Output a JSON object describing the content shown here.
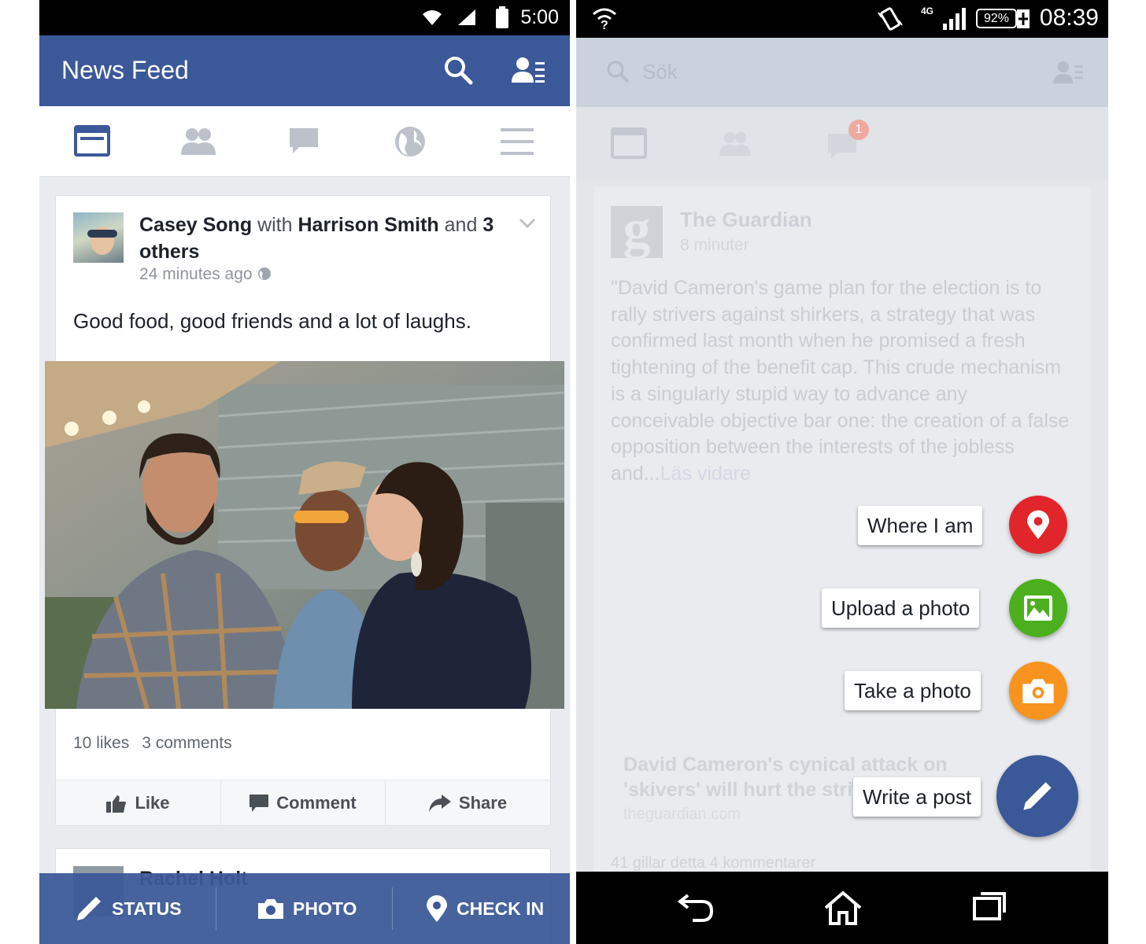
{
  "left_phone": {
    "status_bar": {
      "time": "5:00"
    },
    "app_bar": {
      "title": "News Feed"
    },
    "icons": [
      "search-icon",
      "friend-requests-icon",
      "news-feed-icon",
      "friends-icon",
      "messages-icon",
      "globe-icon",
      "menu-icon"
    ],
    "post": {
      "author": "Casey Song",
      "with_word": "with",
      "tagged": "Harrison Smith",
      "and_word": "and",
      "others": "3 others",
      "time": "24 minutes ago",
      "text": "Good food, good friends and a lot of laughs.",
      "likes": "10 likes",
      "comments": "3 comments",
      "actions": {
        "like": "Like",
        "comment": "Comment",
        "share": "Share"
      }
    },
    "next_post": {
      "author": "Rachel Holt"
    },
    "composer": {
      "status": "STATUS",
      "photo": "PHOTO",
      "checkin": "CHECK IN"
    },
    "colors": {
      "brand": "#3b5998",
      "background": "#e9ebee"
    }
  },
  "right_phone": {
    "status_bar": {
      "time": "08:39",
      "battery": "92%",
      "network": "4G"
    },
    "search": {
      "placeholder": "Sök"
    },
    "notification_badge": "1",
    "post": {
      "source": "The Guardian",
      "time": "8 minuter",
      "text": "\"David Cameron's game plan for the election is to rally strivers against shirkers, a strategy that was confirmed last month when he promised a fresh tightening of the benefit cap. This crude mechanism is a singularly stupid way to advance any conceivable objective bar one: the creation of a false opposition between the interests of the jobless and...",
      "more_link": "Läs vidare",
      "link_title": "David Cameron's cynical attack on 'skivers' will hurt the strivers as well",
      "link_domain": "theguardian.com",
      "counts": "41 gillar detta   4 kommentarer"
    },
    "fab_menu": {
      "where_i_am": "Where I am",
      "upload_photo": "Upload a photo",
      "take_photo": "Take a photo",
      "write_post": "Write a post"
    },
    "colors": {
      "location": "#e0262b",
      "upload": "#4caf1e",
      "camera": "#f7931e",
      "write": "#3b5998"
    }
  }
}
